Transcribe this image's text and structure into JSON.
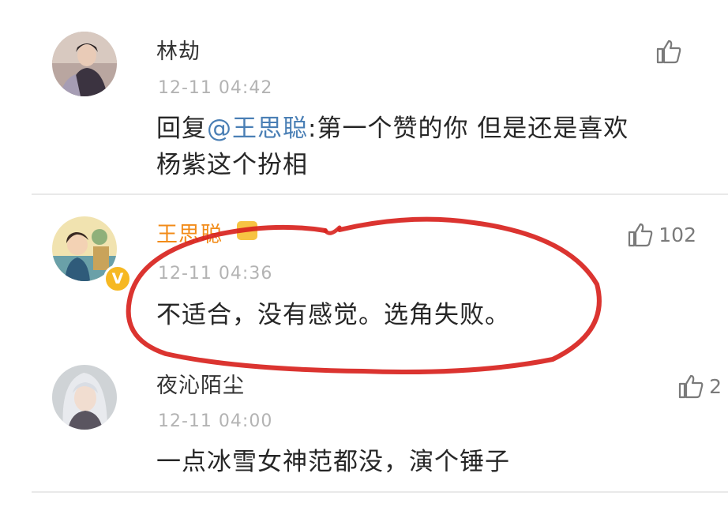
{
  "comments": [
    {
      "username": "林劫",
      "time": "12-11 04:42",
      "reply_prefix": "回复",
      "mention": "@王思聪",
      "text_line1": ":第一个赞的你 但是还是喜欢",
      "text_line2": "杨紫这个扮相",
      "likes": ""
    },
    {
      "username": "王思聪",
      "time": "12-11 04:36",
      "text": "不适合，没有感觉。选角失败。",
      "likes": "102",
      "badge": "V"
    },
    {
      "username": "夜沁陌尘",
      "time": "12-11 04:00",
      "text": "一点冰雪女神范都没，演个锤子",
      "likes": "2"
    }
  ],
  "colors": {
    "vip_name": "#f28b18",
    "mention": "#4a7fb5",
    "annotation": "#d8231e"
  }
}
